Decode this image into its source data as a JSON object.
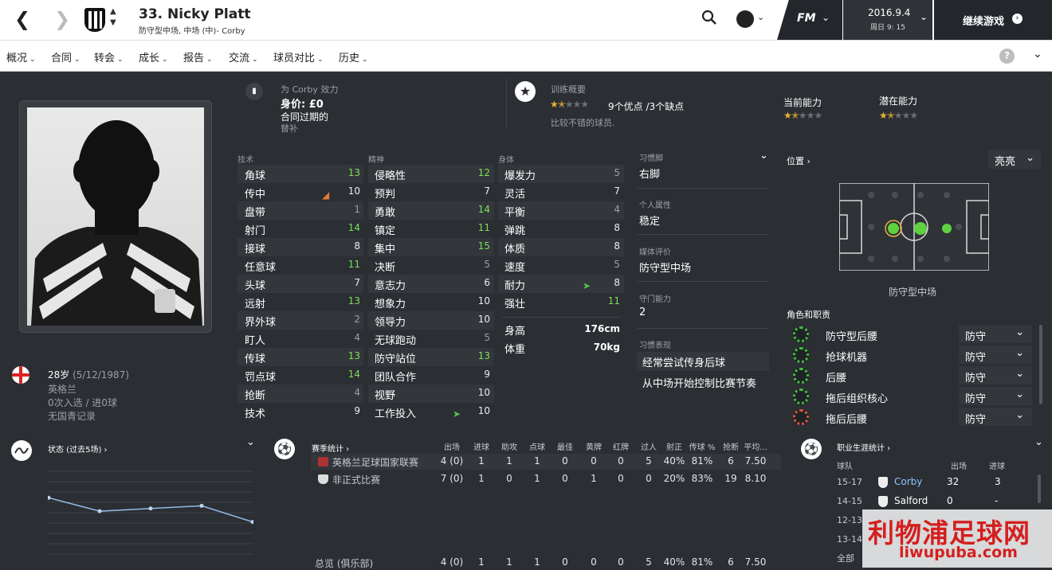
{
  "header": {
    "player_title": "33. Nicky Platt",
    "player_subtitle": "防守型中场, 中场 (中)- Corby",
    "fm_label": "FM",
    "date": "2016.9.4",
    "weekday_time": "周日 9: 15",
    "continue_label": "继续游戏"
  },
  "nav": [
    "概况",
    "合同",
    "转会",
    "成长",
    "报告",
    "交流",
    "球员对比",
    "历史"
  ],
  "club_box": {
    "play_for": "为 Corby 效力",
    "value": "身价: £0",
    "contract": "合同过期的",
    "role": "替补"
  },
  "training": {
    "title": "训练概要",
    "summary": "9个优点 /3个缺点",
    "note": "比较不错的球员.",
    "stars": 1.5
  },
  "ability": {
    "current_label": "当前能力",
    "potential_label": "潜在能力",
    "current_stars": 1.5,
    "potential_stars": 1.5
  },
  "headers": {
    "technical": "技术",
    "mental": "精神",
    "physical": "身体"
  },
  "technical": [
    {
      "name": "角球",
      "value": "13"
    },
    {
      "name": "传中",
      "value": "10"
    },
    {
      "name": "盘带",
      "value": "1"
    },
    {
      "name": "射门",
      "value": "14"
    },
    {
      "name": "接球",
      "value": "8"
    },
    {
      "name": "任意球",
      "value": "11"
    },
    {
      "name": "头球",
      "value": "7"
    },
    {
      "name": "远射",
      "value": "13"
    },
    {
      "name": "界外球",
      "value": "2"
    },
    {
      "name": "盯人",
      "value": "4"
    },
    {
      "name": "传球",
      "value": "13"
    },
    {
      "name": "罚点球",
      "value": "14"
    },
    {
      "name": "抢断",
      "value": "4"
    },
    {
      "name": "技术",
      "value": "9"
    }
  ],
  "mental": [
    {
      "name": "侵略性",
      "value": "12"
    },
    {
      "name": "预判",
      "value": "7"
    },
    {
      "name": "勇敢",
      "value": "14"
    },
    {
      "name": "镇定",
      "value": "11"
    },
    {
      "name": "集中",
      "value": "15"
    },
    {
      "name": "决断",
      "value": "5"
    },
    {
      "name": "意志力",
      "value": "6"
    },
    {
      "name": "想象力",
      "value": "10"
    },
    {
      "name": "领导力",
      "value": "10"
    },
    {
      "name": "无球跑动",
      "value": "5"
    },
    {
      "name": "防守站位",
      "value": "13"
    },
    {
      "name": "团队合作",
      "value": "9"
    },
    {
      "name": "视野",
      "value": "10"
    },
    {
      "name": "工作投入",
      "value": "10"
    }
  ],
  "physical": [
    {
      "name": "爆发力",
      "value": "5"
    },
    {
      "name": "灵活",
      "value": "7"
    },
    {
      "name": "平衡",
      "value": "4"
    },
    {
      "name": "弹跳",
      "value": "8"
    },
    {
      "name": "体质",
      "value": "8"
    },
    {
      "name": "速度",
      "value": "5"
    },
    {
      "name": "耐力",
      "value": "8"
    },
    {
      "name": "强壮",
      "value": "11"
    }
  ],
  "body": {
    "height_label": "身高",
    "height": "176cm",
    "weight_label": "体重",
    "weight": "70kg"
  },
  "info": {
    "foot_label": "习惯脚",
    "foot": "右脚",
    "personality_label": "个人属性",
    "personality": "稳定",
    "media_label": "媒体评价",
    "media": "防守型中场",
    "gk_label": "守门能力",
    "gk": "2",
    "habits_label": "习惯表现",
    "habits": [
      "经常尝试传身后球",
      "从中场开始控制比赛节奏"
    ]
  },
  "position": {
    "title": "位置 ›",
    "highlight": "亮亮",
    "label": "防守型中场",
    "roles_title": "角色和职责"
  },
  "roles": [
    {
      "name": "防守型后腰",
      "duty": "防守",
      "color": "#3fbf3a"
    },
    {
      "name": "抢球机器",
      "duty": "防守",
      "color": "#3fbf3a"
    },
    {
      "name": "后腰",
      "duty": "防守",
      "color": "#3fbf3a"
    },
    {
      "name": "拖后组织核心",
      "duty": "防守",
      "color": "#3fbf3a"
    },
    {
      "name": "拖后后腰",
      "duty": "防守",
      "color": "#d9573a"
    }
  ],
  "personal": {
    "age": "28岁",
    "dob": "(5/12/1987)",
    "nation": "英格兰",
    "caps": "0次入选 / 进0球",
    "youth": "无国青记录"
  },
  "form": {
    "title": "状态 (过去5场) ›",
    "points": [
      7.6,
      7.1,
      7.2,
      7.3,
      6.7
    ]
  },
  "season": {
    "title": "赛季统计 ›",
    "columns": [
      "出场",
      "进球",
      "助攻",
      "点球",
      "最佳",
      "黄牌",
      "红牌",
      "过人",
      "射正",
      "传球 %",
      "抢断",
      "平均..."
    ],
    "rows": [
      {
        "comp": "英格兰足球国家联赛",
        "cells": [
          "4 (0)",
          "1",
          "1",
          "1",
          "0",
          "0",
          "0",
          "5",
          "40%",
          "81%",
          "6",
          "7.50"
        ]
      },
      {
        "comp": "非正式比赛",
        "cells": [
          "7 (0)",
          "1",
          "0",
          "1",
          "0",
          "1",
          "0",
          "0",
          "20%",
          "83%",
          "19",
          "8.10"
        ]
      }
    ],
    "total_label": "总览 (俱乐部)",
    "total": [
      "4 (0)",
      "1",
      "1",
      "1",
      "0",
      "0",
      "0",
      "5",
      "40%",
      "81%",
      "6",
      "7.50"
    ]
  },
  "career": {
    "title": "职业生涯统计 ›",
    "col_team": "球队",
    "col_apps": "出场",
    "col_goals": "进球",
    "rows": [
      {
        "season": "15-17",
        "team": "Corby",
        "apps": "32",
        "goals": "3"
      },
      {
        "season": "14-15",
        "team": "Salford",
        "apps": "0",
        "goals": "-"
      },
      {
        "season": "12-13",
        "team": "",
        "apps": "",
        "goals": ""
      },
      {
        "season": "13-14",
        "team": "",
        "apps": "",
        "goals": ""
      }
    ],
    "all_label": "全部"
  },
  "watermark": {
    "cn": "利物浦足球网",
    "url": "liwupuba.com"
  },
  "colors": {
    "accent_green": "#7ee05a",
    "bg": "#2b2e33",
    "star": "#e8b23a"
  }
}
